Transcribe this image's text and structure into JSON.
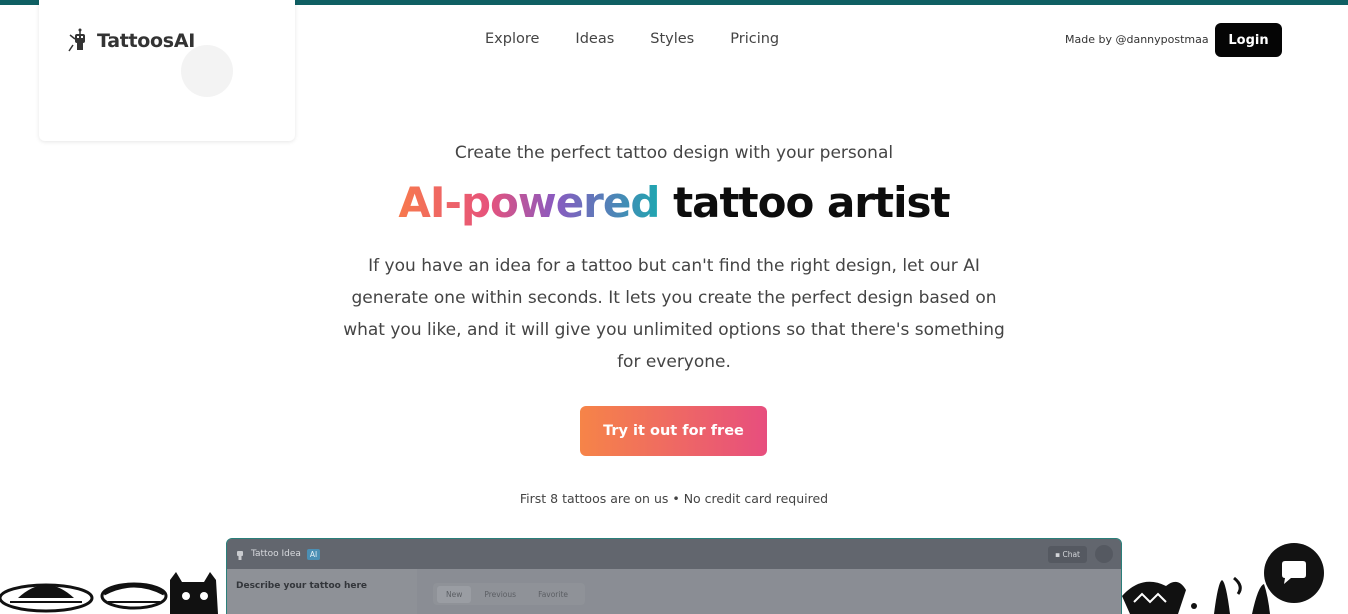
{
  "header": {
    "logo_text": "TattoosAI",
    "nav": [
      "Explore",
      "Ideas",
      "Styles",
      "Pricing"
    ],
    "made_by": "Made by @dannypostmaa",
    "login_label": "Login"
  },
  "hero": {
    "subtitle": "Create the perfect tattoo design with your personal",
    "title_highlight": "AI-powered",
    "title_rest": "tattoo artist",
    "description": "If you have an idea for a tattoo but can't find the right design, let our AI generate one within seconds. It lets you create the perfect design based on what you like, and it will give you unlimited options so that there's something for everyone.",
    "cta_label": "Try it out for free",
    "note": "First 8 tattoos are on us • No credit card required"
  },
  "preview": {
    "title": "Tattoo Idea",
    "badge": "AI",
    "chat_label": "Chat",
    "describe_label": "Describe your tattoo here",
    "tabs": [
      "New",
      "Previous",
      "Favorite"
    ]
  },
  "colors": {
    "topbar": "#0f5f63",
    "login_bg": "#050505",
    "cta_start": "#f68448",
    "cta_end": "#e74e7e"
  },
  "icons": [
    "robot-logo-icon",
    "globe-icon",
    "chat-bubble-icon",
    "user-icon"
  ]
}
